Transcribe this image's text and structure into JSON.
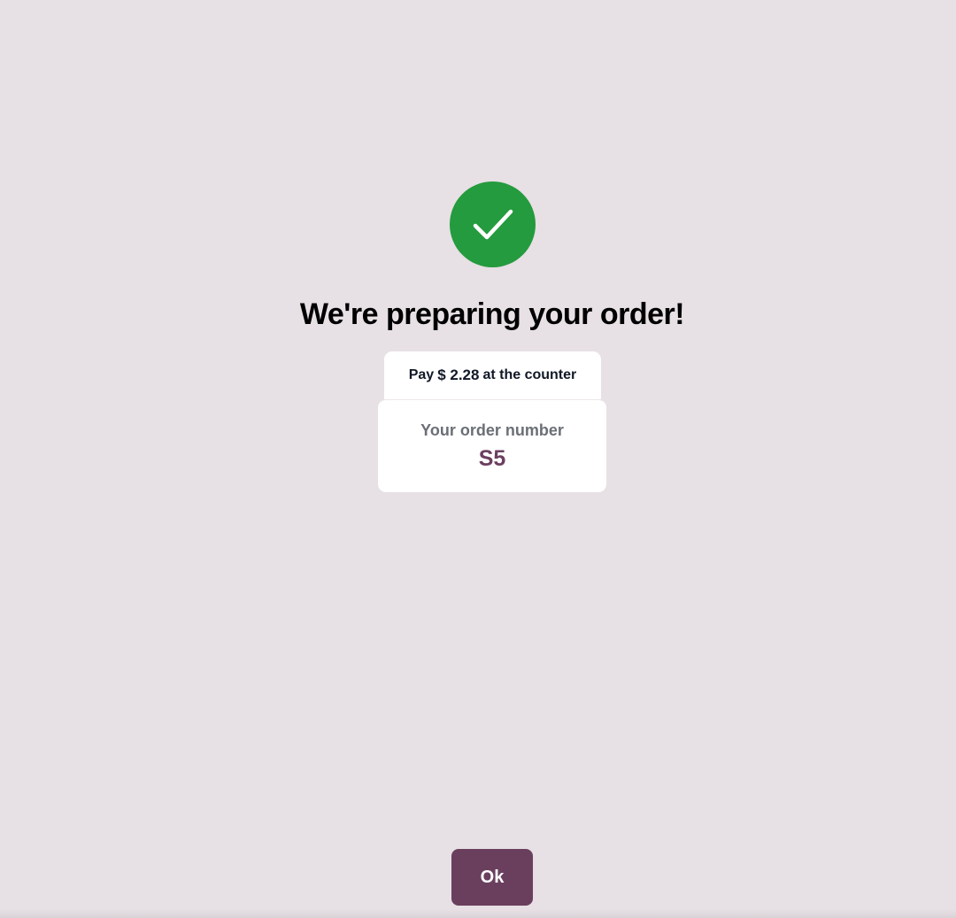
{
  "success_icon": {
    "name": "checkmark-icon",
    "color": "#249b3e"
  },
  "headline": "We're preparing your order!",
  "payment": {
    "prefix": "Pay",
    "amount": "$ 2.28",
    "suffix": "at the counter"
  },
  "order": {
    "label": "Your order number",
    "number": "S5"
  },
  "ok_button_label": "Ok",
  "colors": {
    "background": "#e7e0e4",
    "success": "#249b3e",
    "accent": "#6a3f5e",
    "order_number": "#6c3f5f"
  }
}
